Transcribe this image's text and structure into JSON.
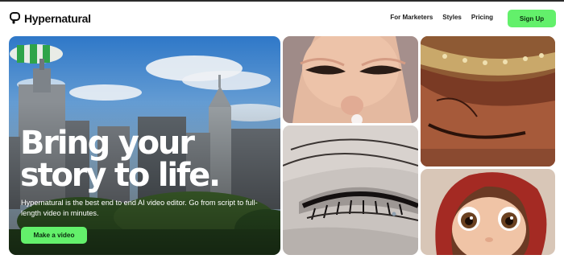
{
  "brand": {
    "name": "Hypernatural",
    "logo_icon": "speech-bubble-icon"
  },
  "nav": {
    "links": [
      "For Marketers",
      "Styles",
      "Pricing"
    ],
    "signup_label": "Sign Up"
  },
  "hero": {
    "title": "Bring your\nstory to life.",
    "description": "Hypernatural is the best end to end AI video editor. Go from script to full-length video in minutes.",
    "cta_label": "Make a video"
  },
  "colors": {
    "accent": "#63f06b",
    "text": "#111111"
  }
}
